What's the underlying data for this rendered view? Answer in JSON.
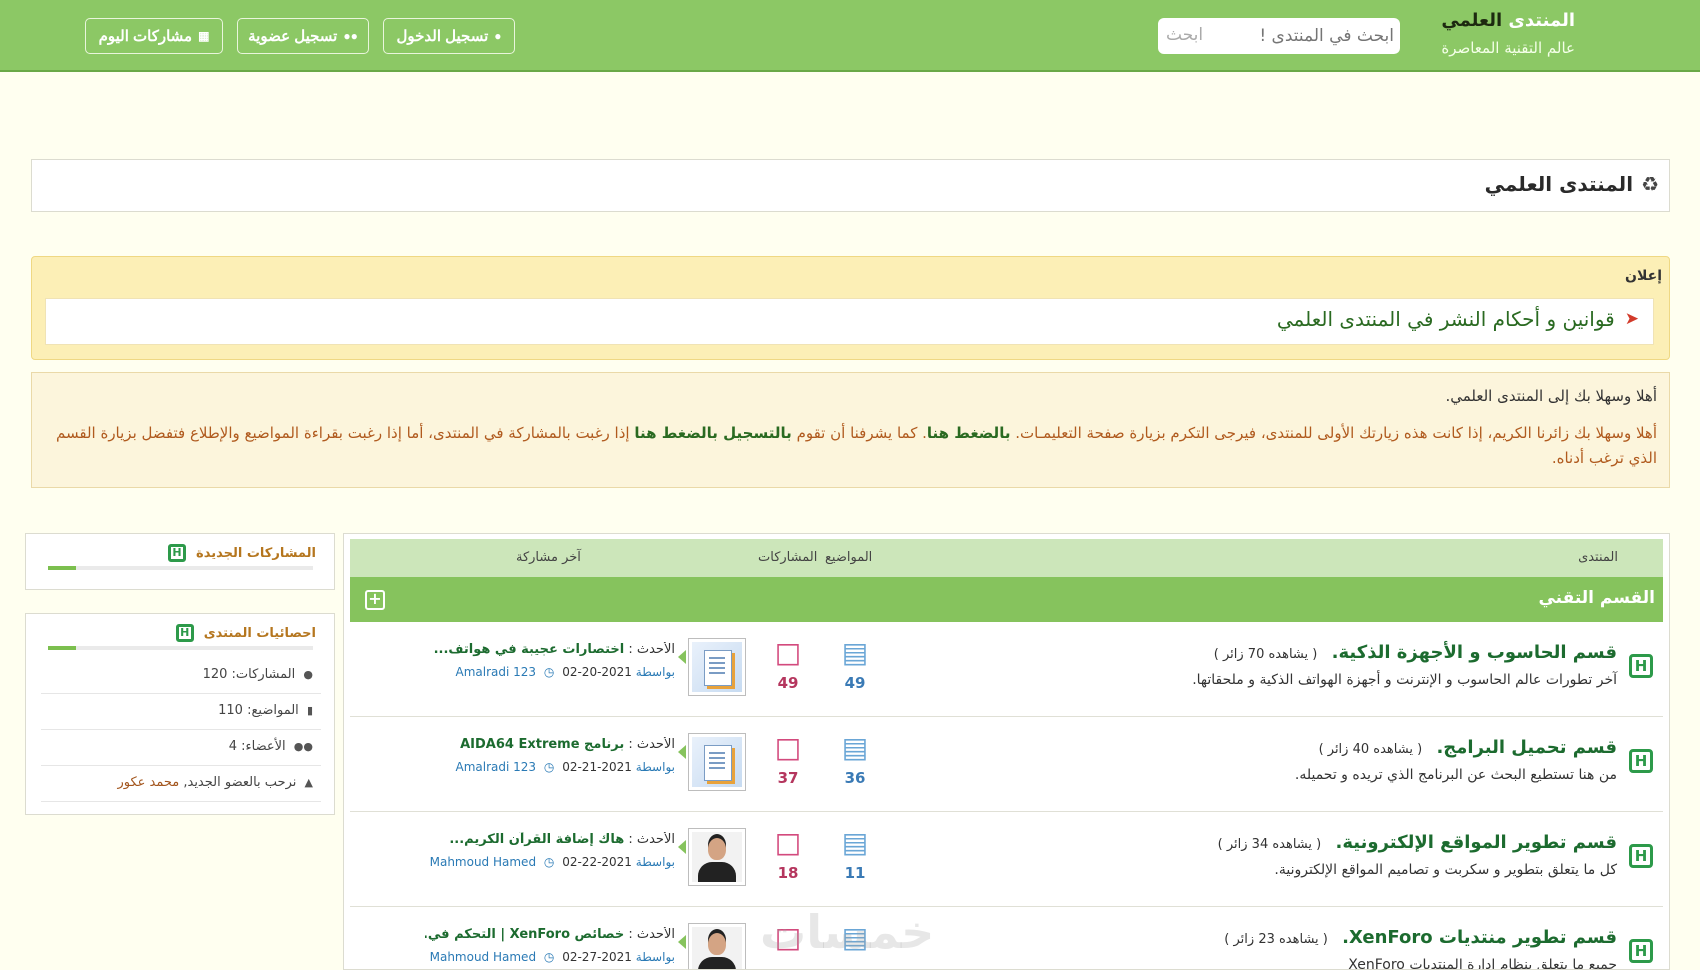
{
  "header": {
    "brand_title_light": "المنتدى",
    "brand_title_bold": "العلمي",
    "brand_tagline": "عالم التقنية المعاصرة",
    "search_placeholder": "ابحث في المنتدى !",
    "search_hint": "ابحث",
    "nav": {
      "login": "تسجيل الدخول",
      "register": "تسجيل عضوية",
      "today_posts": "مشاركات اليوم"
    }
  },
  "page": {
    "title": "المنتدى العلمي"
  },
  "announcement": {
    "label": "إعلان",
    "link_text": "قوانين و أحكام النشر في المنتدى العلمي"
  },
  "welcome": {
    "title": "أهلا وسهلا بك إلى المنتدى العلمي.",
    "text_part1": "أهلا وسهلا بك زائرنا الكريم، إذا كانت هذه زيارتك الأولى للمنتدى، فيرجى التكرم بزيارة صفحة التعليمـات.",
    "link1": "بالضغط هنا",
    "text_part2": ". كما يشرفنا أن تقوم",
    "link2": "بالتسجيل بالضغط هنا",
    "text_part3": "إذا رغبت بالمشاركة في المنتدى، أما إذا رغبت بقراءة المواضيع والإطلاع فتفضل بزيارة القسم الذي ترغب أدناه."
  },
  "forum_table": {
    "columns": {
      "forum": "المنتدى",
      "topics": "المواضيع",
      "posts": "المشاركات",
      "last_post": "آخر مشاركة"
    },
    "category": {
      "title": "القسم التقني",
      "toggle_symbol": "+"
    },
    "rows": [
      {
        "title": "قسم الحاسوب و الأجهزة الذكية.",
        "views": "( يشاهده 70 زائر )",
        "desc": "آخر تطورات عالم الحاسوب و الإنترنت و أجهزة الهواتف الذكية و ملحقاتها.",
        "topics": "49",
        "posts": "49",
        "latest_prefix": "الأحدث :",
        "latest_title": "اختصارات عجيبة في هواتف...",
        "by_label": "بواسطة",
        "author": "Amalradi 123",
        "date": "02-20-2021",
        "avatar": "doc"
      },
      {
        "title": "قسم تحميل البرامج.",
        "views": "( يشاهده 40 زائر )",
        "desc": "من هنا تستطيع البحث عن البرنامج الذي تريده و تحميله.",
        "topics": "36",
        "posts": "37",
        "latest_prefix": "الأحدث :",
        "latest_title": "برنامج AIDA64 Extreme",
        "by_label": "بواسطة",
        "author": "Amalradi 123",
        "date": "02-21-2021",
        "avatar": "doc"
      },
      {
        "title": "قسم تطوير المواقع الإلكترونية.",
        "views": "( يشاهده 34 زائر )",
        "desc": "كل ما يتعلق بتطوير و سكربت و تصاميم المواقع الإلكترونية.",
        "topics": "11",
        "posts": "18",
        "latest_prefix": "الأحدث :",
        "latest_title": "هاك إضافة القرآن الكريم...",
        "by_label": "بواسطة",
        "author": "Mahmoud Hamed",
        "date": "02-22-2021",
        "avatar": "person"
      },
      {
        "title": "قسم تطوير منتديات XenForo.",
        "views": "( يشاهده 23 زائر )",
        "desc": "جميع ما يتعلق بنظام إدارة المنتديات XenForo",
        "topics": "",
        "posts": "",
        "latest_prefix": "الأحدث :",
        "latest_title": "خصائص XenForo | التحكم في...",
        "by_label": "بواسطة",
        "author": "Mahmoud Hamed",
        "date": "02-27-2021",
        "avatar": "person"
      }
    ]
  },
  "sidebar": {
    "new_posts": {
      "title": "المشاركات الجديدة"
    },
    "stats": {
      "title": "احصائيات المنتدى",
      "posts_label": "المشاركات:",
      "posts_value": "120",
      "topics_label": "المواضيع:",
      "topics_value": "110",
      "members_label": "الأعضاء:",
      "members_value": "4",
      "welcome_label": "نرحب بالعضو الجديد,",
      "new_member": "محمد عكور"
    }
  },
  "watermark": "خمسات",
  "colors": {
    "header_green": "#8cc865",
    "category_green": "#86c35d",
    "link_green": "#1c6b2f",
    "notice_yellow": "#fcefb6",
    "page_bg": "#fffff0"
  }
}
